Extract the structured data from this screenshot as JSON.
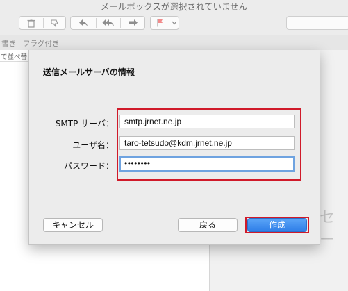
{
  "window": {
    "title": "メールボックスが選択されていません"
  },
  "favorites": {
    "item_drafts": "書き",
    "item_flagged": "フラグ付き"
  },
  "list": {
    "sort_label": "で並べ替"
  },
  "viewer": {
    "ghost_text": "セー"
  },
  "dialog": {
    "title": "送信メールサーバの情報",
    "smtp_label": "SMTP サーバ：",
    "smtp_value": "smtp.jrnet.ne.jp",
    "user_label": "ユーザ名：",
    "user_value": "taro-tetsudo@kdm.jrnet.ne.jp",
    "password_label": "パスワード：",
    "password_dots": "••••••••",
    "cancel_button": "キャンセル",
    "back_button": "戻る",
    "create_button": "作成"
  },
  "colors": {
    "highlight": "#d01a2a",
    "primary": "#2f7fe8"
  }
}
